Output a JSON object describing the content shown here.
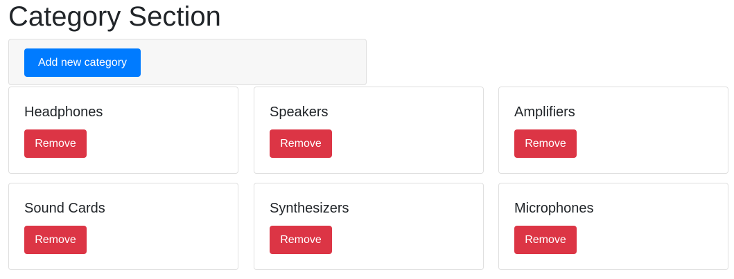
{
  "header": {
    "title": "Category Section"
  },
  "toolbar": {
    "add_label": "Add new category"
  },
  "categories": [
    {
      "name": "Headphones",
      "remove_label": "Remove"
    },
    {
      "name": "Speakers",
      "remove_label": "Remove"
    },
    {
      "name": "Amplifiers",
      "remove_label": "Remove"
    },
    {
      "name": "Sound Cards",
      "remove_label": "Remove"
    },
    {
      "name": "Synthesizers",
      "remove_label": "Remove"
    },
    {
      "name": "Microphones",
      "remove_label": "Remove"
    }
  ],
  "colors": {
    "primary": "#007bff",
    "danger": "#dc3545",
    "toolbar_bg": "#f7f7f7",
    "border": "#dfdfdf",
    "text": "#212529"
  }
}
